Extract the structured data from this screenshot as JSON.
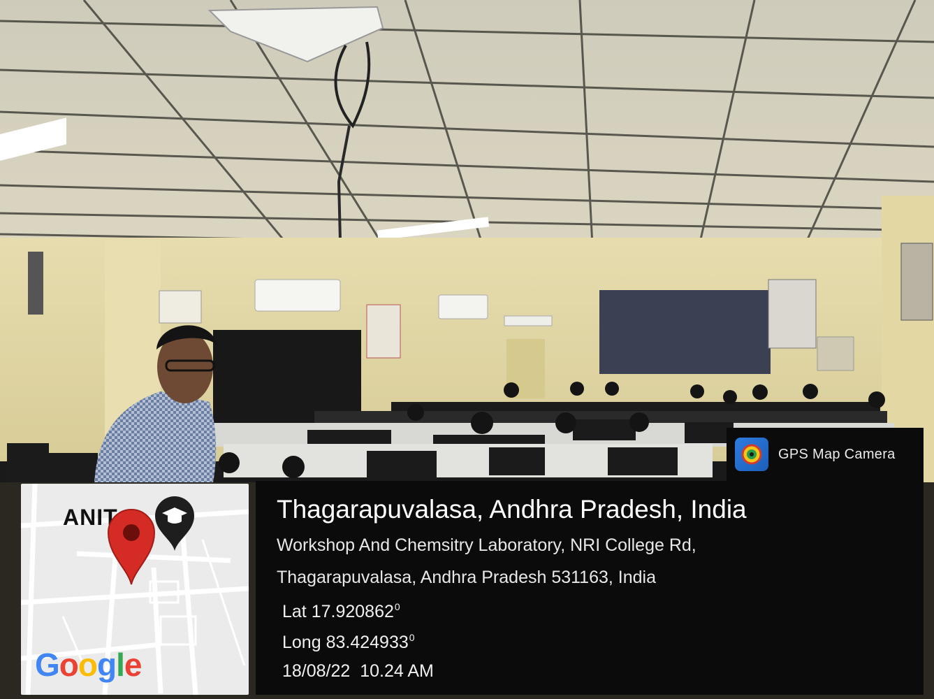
{
  "overlay": {
    "app_name": "GPS Map Camera",
    "app_icon": "camera-lens-icon",
    "location_title": "Thagarapuvalasa, Andhra Pradesh, India",
    "address_line1": "Workshop And Chemsitry Laboratory, NRI College Rd,",
    "address_line2": "Thagarapuvalasa, Andhra Pradesh 531163, India",
    "lat_label": "Lat",
    "lat_value": "17.920862",
    "long_label": "Long",
    "long_value": "83.424933",
    "degree_symbol": "0",
    "date": "18/08/22",
    "time": "10.24 AM"
  },
  "map": {
    "place_label": "ANIT",
    "pin_icon": "map-pin-icon",
    "poi_icon": "graduation-cap-icon",
    "attribution": "Google",
    "colors": {
      "pin": "#d52b25",
      "poi": "#1e1e1e",
      "background": "#ebebeb"
    }
  },
  "scene": {
    "description_colors": {
      "ceiling": "#d9d6c6",
      "wall": "#e2d9a8",
      "desks": "#1c1c1c"
    }
  }
}
